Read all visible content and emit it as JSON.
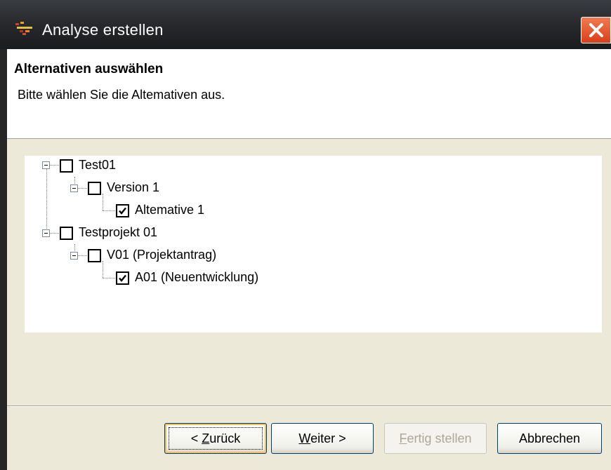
{
  "window": {
    "title": "Analyse erstellen"
  },
  "header": {
    "title": "Alternativen auswählen",
    "description": "Bitte wählen Sie die Altemativen aus."
  },
  "tree": {
    "nodes": [
      {
        "label": "Test01",
        "checked": false
      },
      {
        "label": "Version 1",
        "checked": false
      },
      {
        "label": "Altemative 1",
        "checked": true
      },
      {
        "label": "Testprojekt 01",
        "checked": false
      },
      {
        "label": "V01 (Projektantrag)",
        "checked": false
      },
      {
        "label": "A01 (Neuentwicklung)",
        "checked": true
      }
    ]
  },
  "buttons": {
    "back": {
      "prefix": "< ",
      "accel": "Z",
      "rest": "urück"
    },
    "next": {
      "accel": "W",
      "rest": "eiter >"
    },
    "finish": {
      "accel": "F",
      "rest": "ertig stellen",
      "enabled": false
    },
    "cancel": {
      "label": "Abbrechen"
    }
  }
}
